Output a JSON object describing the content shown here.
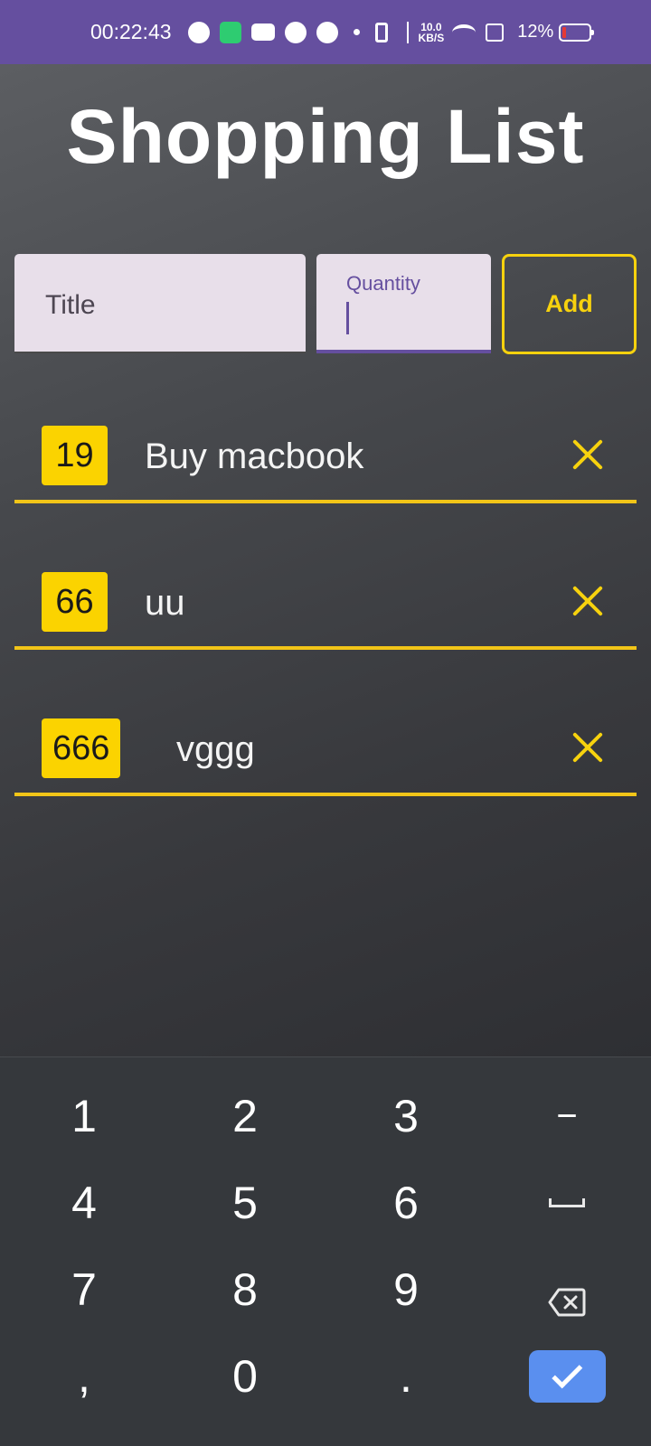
{
  "status_bar": {
    "time": "00:22:43",
    "net_speed_value": "10.0",
    "net_speed_unit": "KB/S",
    "battery_pct": "12%"
  },
  "app": {
    "title": "Shopping List",
    "form": {
      "title_placeholder": "Title",
      "quantity_label": "Quantity",
      "quantity_value": "",
      "add_label": "Add"
    },
    "items": [
      {
        "qty": "19",
        "name": "Buy macbook"
      },
      {
        "qty": "66",
        "name": "uu"
      },
      {
        "qty": "666",
        "name": "vggg"
      }
    ]
  },
  "keyboard": {
    "rows": [
      [
        "1",
        "2",
        "3",
        "−"
      ],
      [
        "4",
        "5",
        "6",
        "space"
      ],
      [
        "7",
        "8",
        "9",
        "backspace"
      ],
      [
        ",",
        "0",
        ".",
        "done"
      ]
    ]
  },
  "colors": {
    "status_bar": "#654f9f",
    "accent_yellow": "#f7d20e",
    "field_bg": "#e8dfea",
    "done_key": "#5a8fef"
  }
}
